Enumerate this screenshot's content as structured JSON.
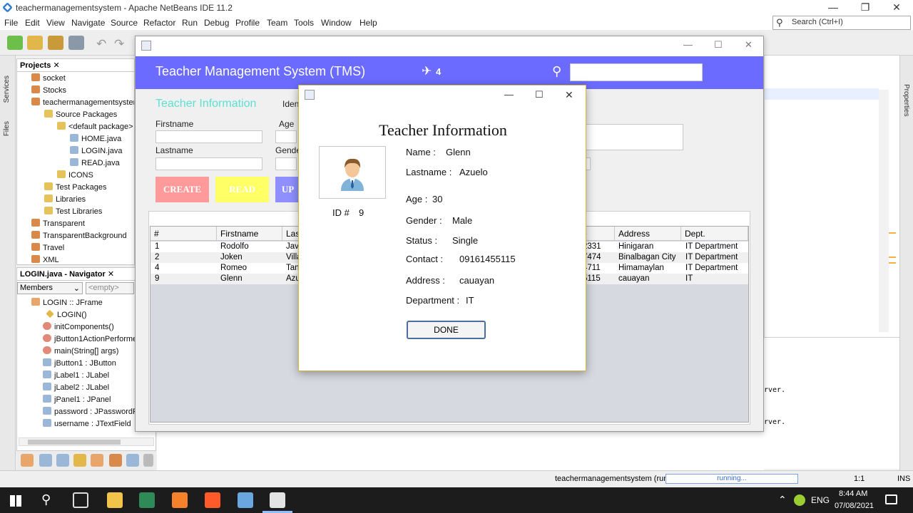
{
  "ide": {
    "title": "teachermanagementsystem - Apache NetBeans IDE 11.2",
    "menu": [
      "File",
      "Edit",
      "View",
      "Navigate",
      "Source",
      "Refactor",
      "Run",
      "Debug",
      "Profile",
      "Team",
      "Tools",
      "Window",
      "Help"
    ],
    "search_placeholder": "Search (Ctrl+I)",
    "projects_tab": "Projects",
    "tree": [
      "socket",
      "Stocks",
      "teachermanagementsystem",
      "Source Packages",
      "<default package>",
      "HOME.java",
      "LOGIN.java",
      "READ.java",
      "ICONS",
      "Test Packages",
      "Libraries",
      "Test Libraries",
      "Transparent",
      "TransparentBackground",
      "Travel",
      "XML"
    ],
    "side_labels": {
      "services": "Services",
      "files": "Files",
      "properties": "Properties"
    },
    "navigator_tab": "LOGIN.java - Navigator",
    "navigator_filter": "Members",
    "navigator_empty": "<empty>",
    "nav_items": [
      "LOGIN :: JFrame",
      "LOGIN()",
      "initComponents()",
      "jButton1ActionPerforme",
      "main(String[] args)",
      "jButton1 : JButton",
      "jLabel1 : JLabel",
      "jLabel2 : JLabel",
      "jPanel1 : JPanel",
      "password : JPasswordFi",
      "username : JTextField"
    ],
    "output_lines": [
      "rver.",
      "rver."
    ],
    "status": {
      "task": "teachermanagementsystem (run)",
      "progress": "running...",
      "position": "1:1",
      "mode": "INS"
    }
  },
  "taskbar": {
    "lang": "ENG",
    "time": "8:44 AM",
    "date": "07/08/2021"
  },
  "tms": {
    "header_title": "Teacher Management System (TMS)",
    "badge_count": "4",
    "section_title": "Teacher Information",
    "labels": {
      "firstname": "Firstname",
      "lastname": "Lastname",
      "age": "Age",
      "gender": "Gende",
      "ident": "Iden"
    },
    "buttons": {
      "create": "CREATE",
      "read": "READ",
      "update": "UP"
    },
    "table": {
      "columns": [
        "#",
        "Firstname",
        "Las",
        "e",
        "Address",
        "Dept."
      ],
      "rows": [
        [
          "1",
          "Rodolfo",
          "Jav",
          "2331",
          "Hinigaran",
          "IT Department"
        ],
        [
          "2",
          "Joken",
          "Villa",
          "7474",
          "Binalbagan City",
          "IT Department"
        ],
        [
          "4",
          "Romeo",
          "Tan",
          "4711",
          "Himamaylan",
          "IT Department"
        ],
        [
          "9",
          "Glenn",
          "Azu",
          "5115",
          "cauayan",
          "IT"
        ]
      ]
    }
  },
  "dialog": {
    "title": "Teacher Information",
    "id_label": "ID #",
    "id_value": "9",
    "name_label": "Name :",
    "name_value": "Glenn",
    "lastname_label": "Lastname :",
    "lastname_value": "Azuelo",
    "age_label": "Age :",
    "age_value": "30",
    "gender_label": "Gender :",
    "gender_value": "Male",
    "status_label": "Status :",
    "status_value": "Single",
    "contact_label": "Contact :",
    "contact_value": "09161455115",
    "address_label": "Address :",
    "address_value": "cauayan",
    "department_label": "Department :",
    "department_value": "IT",
    "done_label": "DONE"
  },
  "colors": {
    "header": "#6b6bff",
    "create": "#ff9a9a",
    "read": "#ffff66",
    "update": "#8f8fff",
    "section": "#5ee0d0"
  }
}
